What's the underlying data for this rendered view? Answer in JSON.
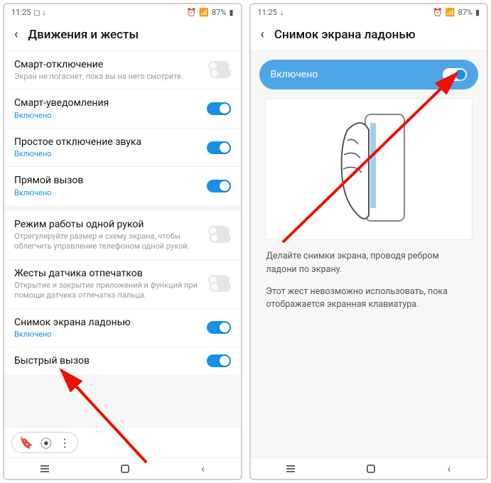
{
  "left": {
    "status": {
      "time": "11:25",
      "icons_left": "▣ ⬇",
      "icons_right": "⏰ 📶 ⚡ 87% 🔋",
      "battery": "87%"
    },
    "header": {
      "title": "Движения и жесты"
    },
    "groups": [
      [
        {
          "title": "Смарт-отключение",
          "sub": "Экран не погаснет, пока вы на него смотрите.",
          "subBlue": false,
          "toggle": "double-off"
        },
        {
          "title": "Смарт-уведомления",
          "sub": "Включено",
          "subBlue": true,
          "toggle": "on"
        },
        {
          "title": "Простое отключение звука",
          "sub": "Включено",
          "subBlue": true,
          "toggle": "on"
        },
        {
          "title": "Прямой вызов",
          "sub": "Включено",
          "subBlue": true,
          "toggle": "on"
        }
      ],
      [
        {
          "title": "Режим работы одной рукой",
          "sub": "Отрегулируйте размер и схему экрана, чтобы облегчить управление телефоном одной рукой.",
          "subBlue": false,
          "toggle": "double-off"
        },
        {
          "title": "Жесты датчика отпечатков",
          "sub": "Открытие и закрытие приложений и функций при помощи датчика отпечатка пальца.",
          "subBlue": false,
          "toggle": "double-off"
        },
        {
          "title": "Снимок экрана ладонью",
          "sub": "Включено",
          "subBlue": true,
          "toggle": "on"
        },
        {
          "title": "Быстрый вызов",
          "sub": "",
          "subBlue": false,
          "toggle": "on"
        }
      ]
    ]
  },
  "right": {
    "status": {
      "time": "11:25",
      "icons_left": "⬇",
      "icons_right": "⏰ 📶 ⚡ 87% 🔋",
      "battery": "87%"
    },
    "header": {
      "title": "Снимок экрана ладонью"
    },
    "banner": {
      "label": "Включено",
      "toggle": "on"
    },
    "desc1": "Делайте снимки экрана, проводя ребром ладони по экрану.",
    "desc2": "Этот жест невозможно использовать, пока отображается экранная клавиатура."
  }
}
